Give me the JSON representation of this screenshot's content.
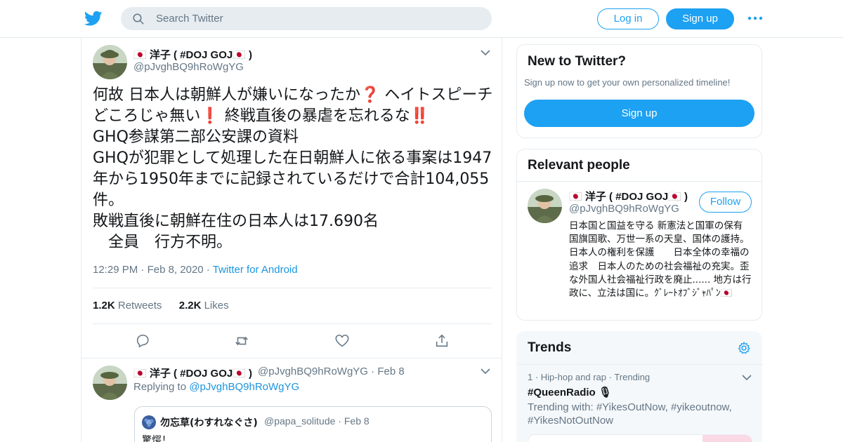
{
  "colors": {
    "brand": "#1da1f2",
    "link": "#1b95e0",
    "muted": "#657786",
    "text": "#14171a",
    "border": "#e6ecf0",
    "search_bg": "#e6ecf0"
  },
  "header": {
    "logo_icon": "twitter-bird-icon",
    "search_placeholder": "Search Twitter",
    "login_label": "Log in",
    "signup_label": "Sign up",
    "more_icon": "more-dots-icon"
  },
  "tweet": {
    "name": "🇯🇵 洋子 ( #DOJ GOJ🇯🇵 )",
    "handle": "@pJvghBQ9hRoWgYG",
    "text": "何故 日本人は朝鮮人が嫌いになったか❓ ヘイトスピーチどころじゃ無い❗ 終戦直後の暴虐を忘れるな‼️\nGHQ参謀第二部公安課の資料\nGHQが犯罪として処理した在日朝鮮人に依る事案は1947年から1950年までに記録されているだけで合計104,055件。\n敗戦直後に朝鮮在住の日本人は17.690名\n　全員　行方不明。",
    "time": "12:29 PM",
    "date": "Feb 8, 2020",
    "source": "Twitter for Android",
    "retweets_count": "1.2K",
    "retweets_label": "Retweets",
    "likes_count": "2.2K",
    "likes_label": "Likes",
    "action_icons": [
      "reply-icon",
      "retweet-icon",
      "like-icon",
      "share-icon"
    ]
  },
  "reply": {
    "name": "🇯🇵 洋子 ( #DOJ GOJ🇯🇵 )",
    "handle": "@pJvghBQ9hRoWgYG",
    "date": "Feb 8",
    "replying_label": "Replying to",
    "replying_handle": "@pJvghBQ9hRoWgYG",
    "quote": {
      "name": "勿忘草(わすれなぐさ)",
      "handle": "@papa_solitude",
      "date": "Feb 8",
      "text": "驚愕！"
    }
  },
  "sidebar": {
    "new": {
      "title": "New to Twitter?",
      "subtitle": "Sign up now to get your own personalized timeline!",
      "button_label": "Sign up"
    },
    "relevant": {
      "title": "Relevant people",
      "name": "🇯🇵 洋子 ( #DOJ GOJ🇯🇵 )",
      "handle": "@pJvghBQ9hRoWgYG",
      "follow_label": "Follow",
      "bio": "日本国と国益を守る 新憲法と国軍の保有　　国旗国歌、万世一系の天皇、国体の護持。日本人の権利を保護　　日本全体の幸福の追求　日本人のための社会福祉の充実。歪な外国人社会福祉行政を廃止...... 地方は行政に、立法は国に。ｸﾞﾚｰﾄｵﾌﾞｼﾞｬﾊﾟﾝ🇯🇵"
    },
    "trends": {
      "title": "Trends",
      "settings_icon": "gear-icon",
      "item": {
        "context": "1 · Hip-hop and rap · Trending",
        "hashtag": "#QueenRadio 🎙",
        "trending_with": "Trending with: #YikesOutNow, #yikeoutnow, #YikesNotOutNow"
      }
    }
  }
}
